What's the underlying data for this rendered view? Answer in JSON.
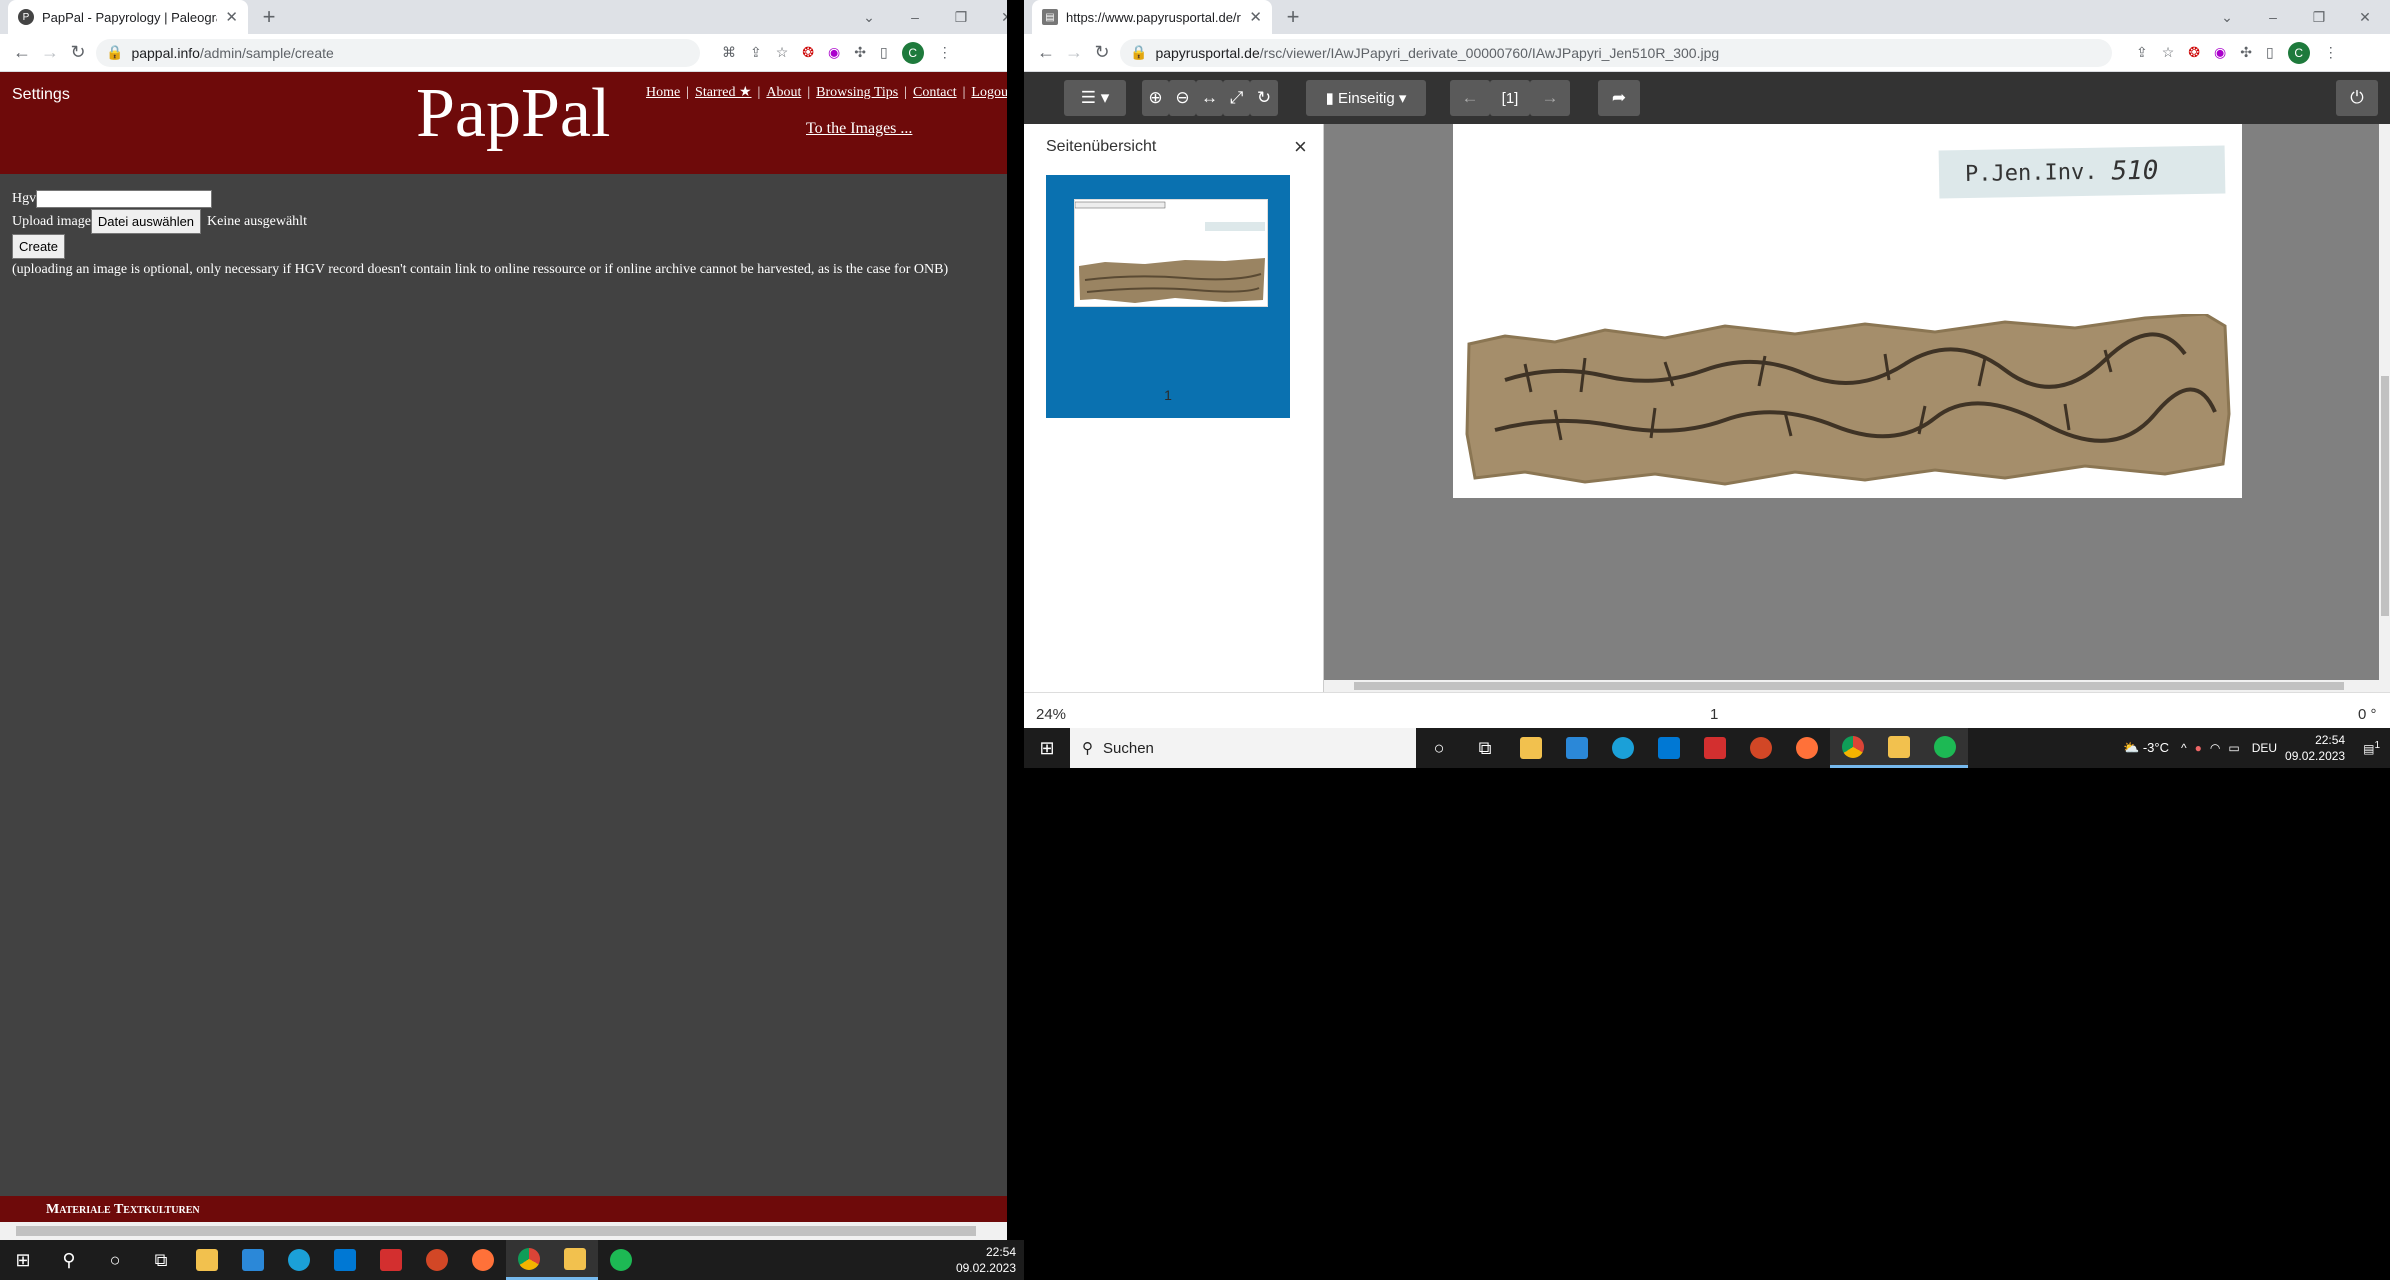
{
  "left_window": {
    "tab": {
      "title": "PapPal - Papyrology | Paleograph",
      "favicon": "P"
    },
    "url": {
      "host": "pappal.info",
      "path": "/admin/sample/create"
    },
    "profile_initial": "C",
    "pappal": {
      "settings_label": "Settings",
      "logo": "PapPal",
      "nav": [
        {
          "label": "Home"
        },
        {
          "label": "Starred ★"
        },
        {
          "label": "About"
        },
        {
          "label": "Browsing Tips"
        },
        {
          "label": "Contact"
        },
        {
          "label": "Logou"
        }
      ],
      "nav_sep": "|",
      "to_images": "To the Images ...",
      "form": {
        "hgv_label": "Hgv",
        "hgv_value": "",
        "upload_label": "Upload image",
        "file_button": "Datei auswählen",
        "file_status": "Keine ausgewählt",
        "create_button": "Create",
        "note": "(uploading an image is optional, only necessary if HGV record doesn't contain link to online ressource or if online archive cannot be harvested, as is the case for ONB)"
      },
      "footer_text": "Materiale Textkulturen"
    }
  },
  "left_taskbar": {
    "time": "22:54",
    "date": "09.02.2023"
  },
  "right_window": {
    "tab": {
      "title": "https://www.papyrusportal.de/rs"
    },
    "url": {
      "host": "papyrusportal.de",
      "path": "/rsc/viewer/IAwJPapyri_derivate_00000760/IAwJPapyri_Jen510R_300.jpg"
    },
    "profile_initial": "C",
    "viewer": {
      "view_mode": "Einseitig",
      "page_indicator": "[1]",
      "sidebar_title": "Seitenübersicht",
      "thumb_page_number": "1",
      "label_text": "P.Jen.Inv.",
      "label_number": "510",
      "zoom": "24%",
      "current_page": "1",
      "rotation": "0 °"
    }
  },
  "right_taskbar": {
    "search_placeholder": "Suchen",
    "weather": "-3°C",
    "language": "DEU",
    "time": "22:54",
    "date": "09.02.2023",
    "notification_count": "1"
  },
  "colors": {
    "pappal_red": "#6e0a0a",
    "pappal_bg": "#424242",
    "viewer_toolbar": "#333333",
    "thumb_selected": "#0a71b0"
  }
}
